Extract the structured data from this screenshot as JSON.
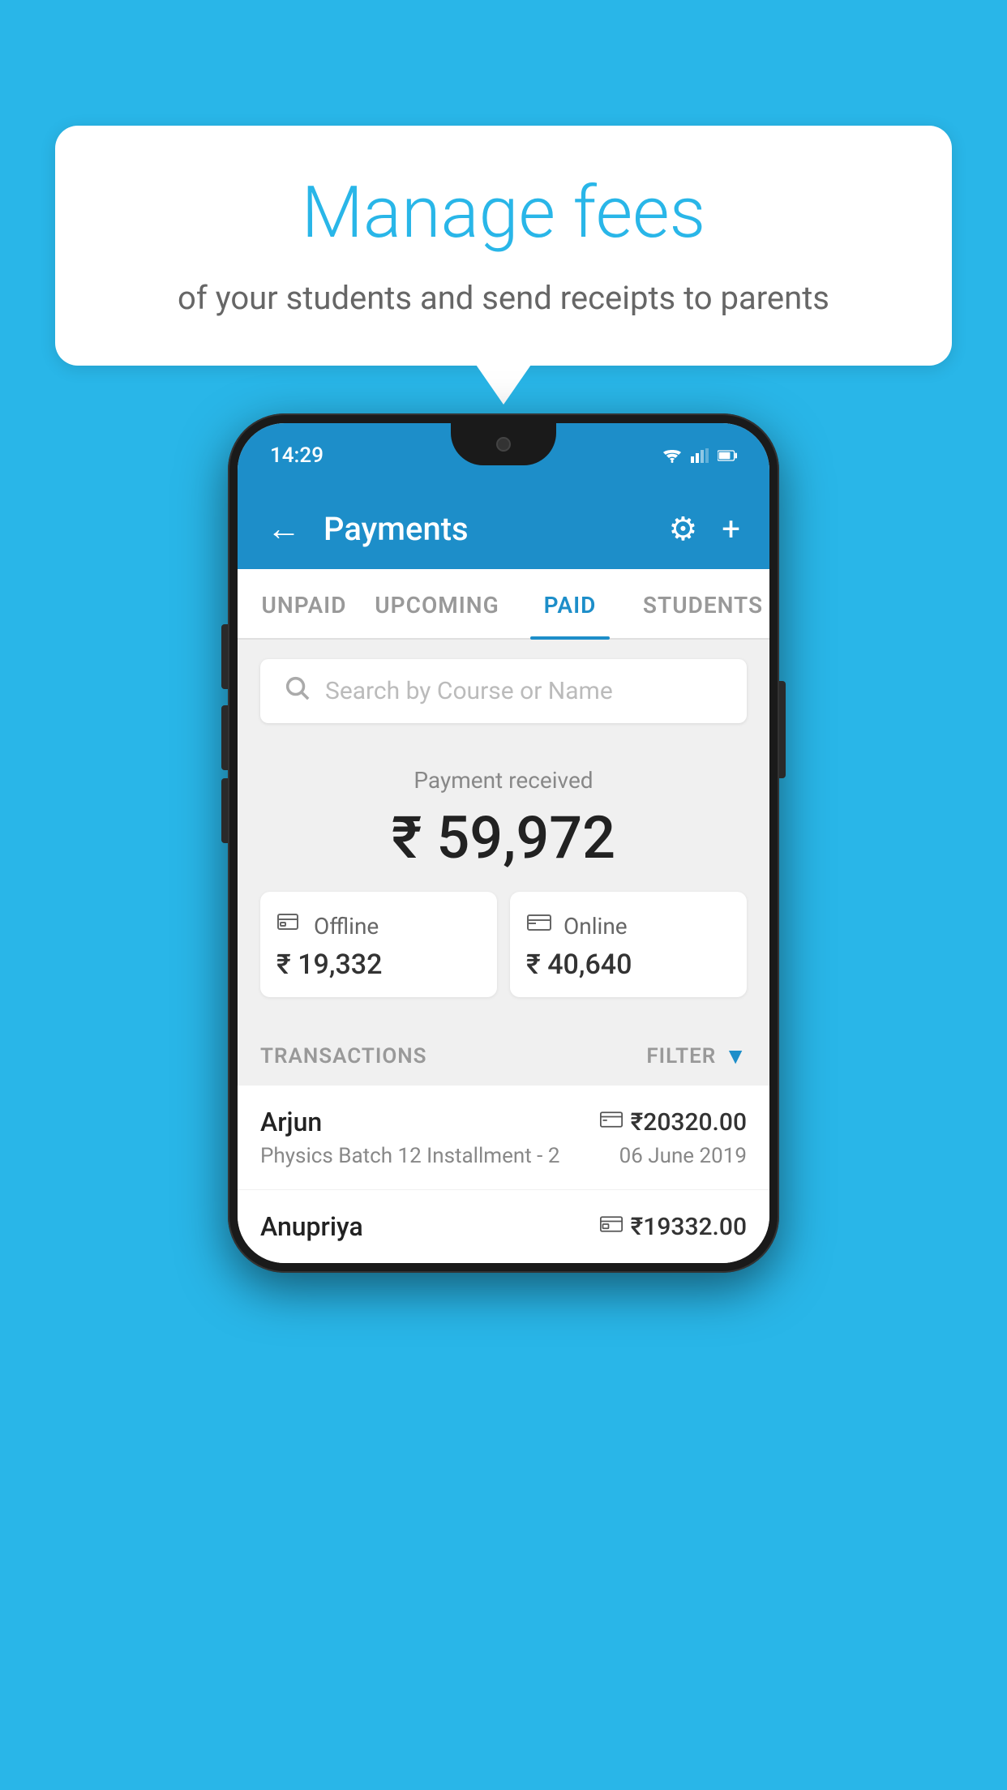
{
  "background_color": "#29b6e8",
  "bubble": {
    "title": "Manage fees",
    "subtitle": "of your students and send receipts to parents"
  },
  "phone": {
    "status_bar": {
      "time": "14:29"
    },
    "app_bar": {
      "title": "Payments",
      "back_label": "←",
      "settings_label": "⚙",
      "add_label": "+"
    },
    "tabs": [
      {
        "label": "UNPAID",
        "active": false
      },
      {
        "label": "UPCOMING",
        "active": false
      },
      {
        "label": "PAID",
        "active": true
      },
      {
        "label": "STUDENTS",
        "active": false
      }
    ],
    "search": {
      "placeholder": "Search by Course or Name"
    },
    "payment_summary": {
      "label": "Payment received",
      "amount": "₹ 59,972",
      "offline": {
        "label": "Offline",
        "amount": "₹ 19,332"
      },
      "online": {
        "label": "Online",
        "amount": "₹ 40,640"
      }
    },
    "transactions": {
      "header_label": "TRANSACTIONS",
      "filter_label": "FILTER",
      "items": [
        {
          "name": "Arjun",
          "course": "Physics Batch 12 Installment - 2",
          "amount": "₹20320.00",
          "date": "06 June 2019",
          "type": "online"
        },
        {
          "name": "Anupriya",
          "amount": "₹19332.00",
          "type": "offline"
        }
      ]
    }
  }
}
